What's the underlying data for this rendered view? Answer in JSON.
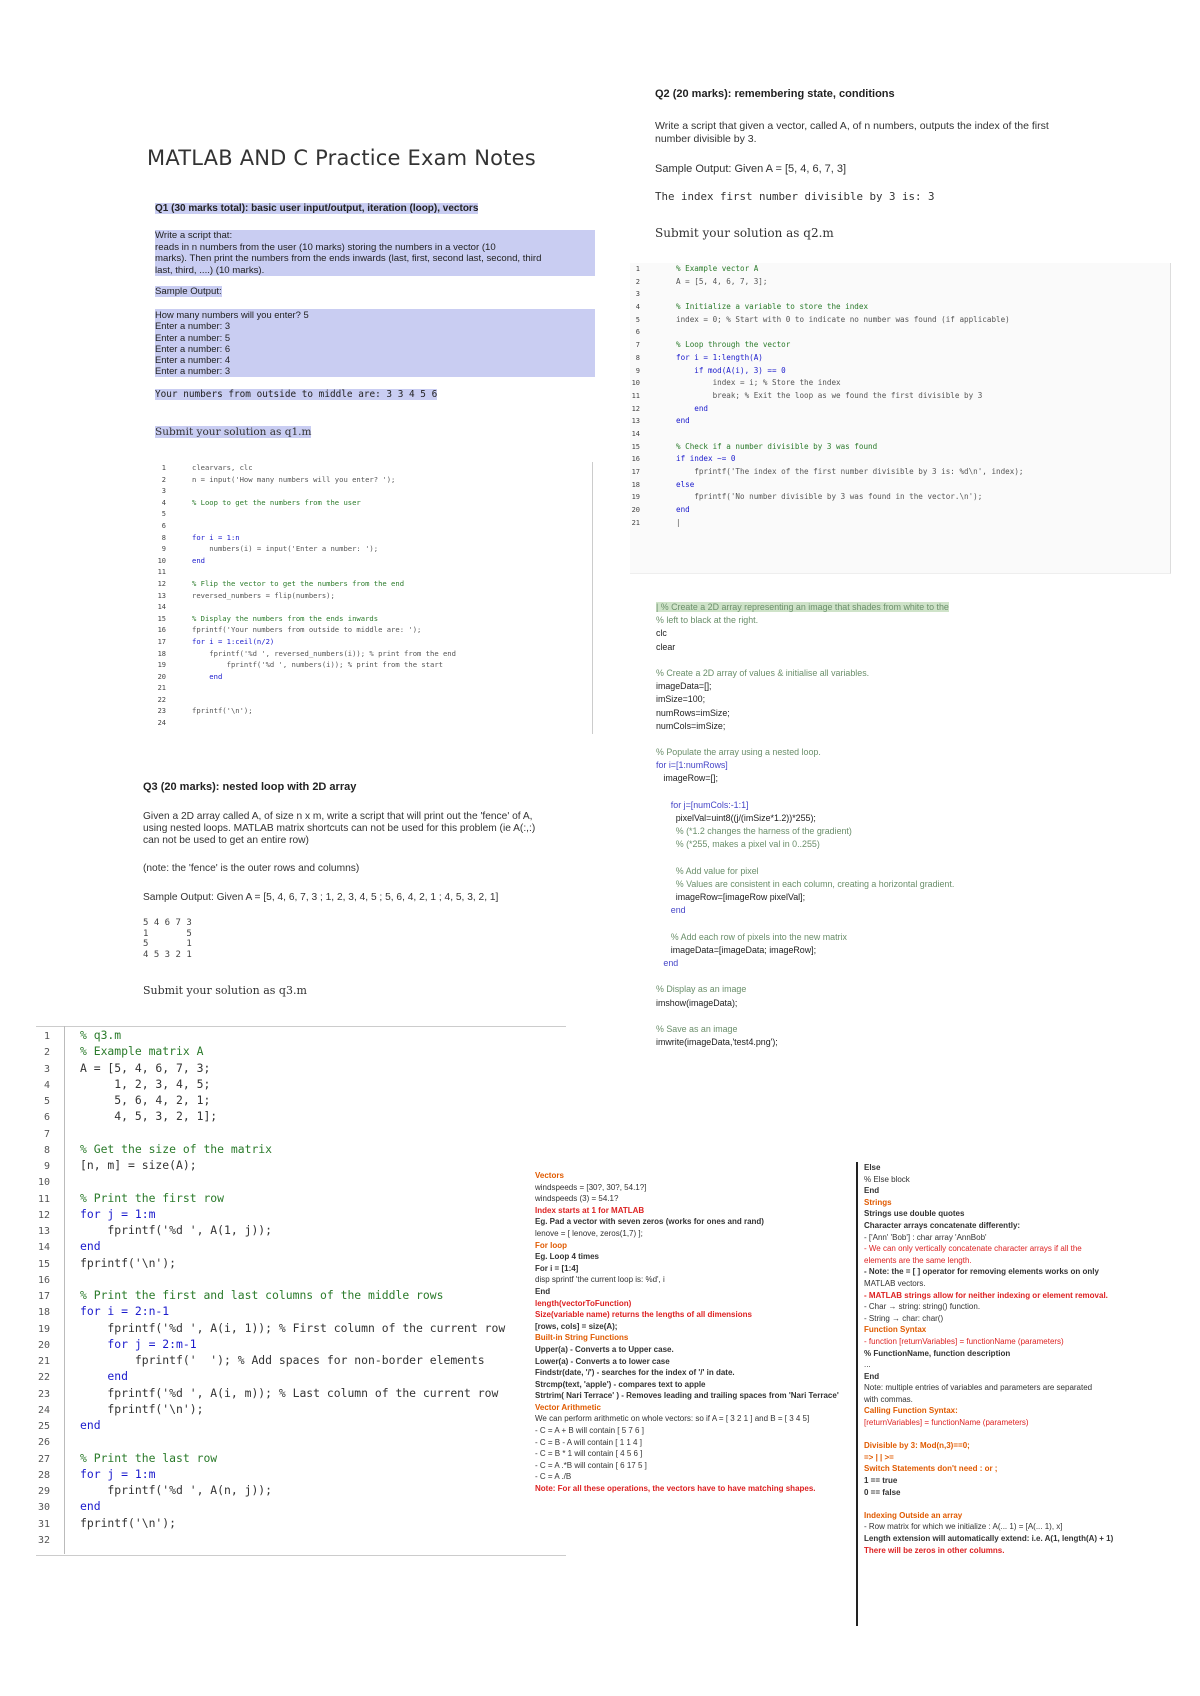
{
  "title": "MATLAB AND C Practice Exam Notes",
  "q1": {
    "heading": "Q1 (30 marks total): basic user input/output, iteration (loop), vectors",
    "prompt": [
      "Write a script that:",
      "reads in n numbers from the user (10 marks) storing the numbers in a vector (10",
      "marks).  Then print the numbers from the ends inwards (last, first, second last, second, third",
      "last, third, ....) (10 marks)."
    ],
    "sample_label": "Sample Output:",
    "sample_lines": [
      "How many numbers will you enter? 5",
      "Enter a number:  3",
      "Enter a number:  5",
      "Enter a number:  6",
      "Enter a number:  4",
      "Enter a number:  3"
    ],
    "result_line": "Your numbers from outside to middle are: 3 3 4 5 6",
    "submit": "Submit your solution as q1.m",
    "code": [
      {
        "n": "1",
        "t": "clearvars, clc",
        "c": ""
      },
      {
        "n": "2",
        "t": "n = input('How many numbers will you enter? ');",
        "c": ""
      },
      {
        "n": "3",
        "t": "",
        "c": ""
      },
      {
        "n": "4",
        "t": "% Loop to get the numbers from the user",
        "c": "cmt"
      },
      {
        "n": "5",
        "t": "",
        "c": ""
      },
      {
        "n": "6",
        "t": "",
        "c": ""
      },
      {
        "n": "8",
        "t": "for i = 1:n",
        "c": "kw"
      },
      {
        "n": "9",
        "t": "    numbers(i) = input('Enter a number: ');",
        "c": ""
      },
      {
        "n": "10",
        "t": "end",
        "c": "kw"
      },
      {
        "n": "11",
        "t": "",
        "c": ""
      },
      {
        "n": "12",
        "t": "% Flip the vector to get the numbers from the end",
        "c": "cmt"
      },
      {
        "n": "13",
        "t": "reversed_numbers = flip(numbers);",
        "c": ""
      },
      {
        "n": "14",
        "t": "",
        "c": ""
      },
      {
        "n": "15",
        "t": "% Display the numbers from the ends inwards",
        "c": "cmt"
      },
      {
        "n": "16",
        "t": "fprintf('Your numbers from outside to middle are: ');",
        "c": ""
      },
      {
        "n": "17",
        "t": "for i = 1:ceil(n/2)",
        "c": "kw"
      },
      {
        "n": "18",
        "t": "    fprintf('%d ', reversed_numbers(i)); % print from the end",
        "c": ""
      },
      {
        "n": "19",
        "t": "        fprintf('%d ', numbers(i)); % print from the start",
        "c": ""
      },
      {
        "n": "20",
        "t": "    end",
        "c": "kw"
      },
      {
        "n": "21",
        "t": "",
        "c": ""
      },
      {
        "n": "22",
        "t": "",
        "c": ""
      },
      {
        "n": "23",
        "t": "fprintf('\\n');",
        "c": ""
      },
      {
        "n": "24",
        "t": "",
        "c": ""
      }
    ]
  },
  "q2": {
    "heading": "Q2 (20 marks):  remembering state, conditions",
    "prompt": [
      "Write a script that given a vector, called A, of n numbers, outputs the index of the first",
      "number divisible by 3."
    ],
    "sample": "Sample Output:  Given A = [5, 4, 6, 7, 3]",
    "result_line": "The index first number divisible by 3 is: 3",
    "submit": "Submit your solution as q2.m",
    "code": [
      {
        "n": "1",
        "t": "% Example vector A",
        "c": "cmt"
      },
      {
        "n": "2",
        "t": "A = [5, 4, 6, 7, 3];",
        "c": ""
      },
      {
        "n": "3",
        "t": "",
        "c": ""
      },
      {
        "n": "4",
        "t": "% Initialize a variable to store the index",
        "c": "cmt"
      },
      {
        "n": "5",
        "t": "index = 0; % Start with 0 to indicate no number was found (if applicable)",
        "c": ""
      },
      {
        "n": "6",
        "t": "",
        "c": ""
      },
      {
        "n": "7",
        "t": "% Loop through the vector",
        "c": "cmt"
      },
      {
        "n": "8",
        "t": "for i = 1:length(A)",
        "c": "kw"
      },
      {
        "n": "9",
        "t": "    if mod(A(i), 3) == 0",
        "c": "kw"
      },
      {
        "n": "10",
        "t": "        index = i; % Store the index",
        "c": ""
      },
      {
        "n": "11",
        "t": "        break; % Exit the loop as we found the first divisible by 3",
        "c": ""
      },
      {
        "n": "12",
        "t": "    end",
        "c": "kw"
      },
      {
        "n": "13",
        "t": "end",
        "c": "kw"
      },
      {
        "n": "14",
        "t": "",
        "c": ""
      },
      {
        "n": "15",
        "t": "% Check if a number divisible by 3 was found",
        "c": "cmt"
      },
      {
        "n": "16",
        "t": "if index ~= 0",
        "c": "kw"
      },
      {
        "n": "17",
        "t": "    fprintf('The index of the first number divisible by 3 is: %d\\n', index);",
        "c": ""
      },
      {
        "n": "18",
        "t": "else",
        "c": "kw"
      },
      {
        "n": "19",
        "t": "    fprintf('No number divisible by 3 was found in the vector.\\n');",
        "c": ""
      },
      {
        "n": "20",
        "t": "end",
        "c": "kw"
      },
      {
        "n": "21",
        "t": "|",
        "c": ""
      }
    ]
  },
  "image_notes": [
    {
      "t": "| % Create a 2D array representing an image that shades from white to the",
      "c": "cmt hlg"
    },
    {
      "t": "% left to black at the right.",
      "c": "cmt"
    },
    {
      "t": "clc",
      "c": ""
    },
    {
      "t": "clear",
      "c": ""
    },
    {
      "t": "",
      "c": ""
    },
    {
      "t": "% Create a 2D array of values & initialise all variables.",
      "c": "cmt"
    },
    {
      "t": "imageData=[];",
      "c": ""
    },
    {
      "t": "imSize=100;",
      "c": ""
    },
    {
      "t": "numRows=imSize;",
      "c": ""
    },
    {
      "t": "numCols=imSize;",
      "c": ""
    },
    {
      "t": "",
      "c": ""
    },
    {
      "t": "% Populate the array using a nested loop.",
      "c": "cmt"
    },
    {
      "t": "for i=[1:numRows]",
      "c": "kw"
    },
    {
      "t": "   imageRow=[];",
      "c": ""
    },
    {
      "t": "",
      "c": ""
    },
    {
      "t": "      for j=[numCols:-1:1]",
      "c": "kw"
    },
    {
      "t": "        pixelVal=uint8((j/(imSize*1.2))*255);",
      "c": ""
    },
    {
      "t": "        % (*1.2 changes the harness of the gradient)",
      "c": "cmt"
    },
    {
      "t": "        % (*255, makes a pixel val in 0..255)",
      "c": "cmt"
    },
    {
      "t": "",
      "c": ""
    },
    {
      "t": "        % Add value for pixel",
      "c": "cmt"
    },
    {
      "t": "        % Values are consistent in each column, creating a horizontal gradient.",
      "c": "cmt"
    },
    {
      "t": "        imageRow=[imageRow pixelVal];",
      "c": ""
    },
    {
      "t": "      end",
      "c": "kw"
    },
    {
      "t": "",
      "c": ""
    },
    {
      "t": "      % Add each row of pixels into the new matrix",
      "c": "cmt"
    },
    {
      "t": "      imageData=[imageData; imageRow];",
      "c": ""
    },
    {
      "t": "   end",
      "c": "kw"
    },
    {
      "t": "",
      "c": ""
    },
    {
      "t": "% Display as an image",
      "c": "cmt"
    },
    {
      "t": "imshow(imageData);",
      "c": ""
    },
    {
      "t": "",
      "c": ""
    },
    {
      "t": "% Save as an image",
      "c": "cmt"
    },
    {
      "t": "imwrite(imageData,'test4.png');",
      "c": ""
    }
  ],
  "q3": {
    "heading": "Q3 (20 marks): nested loop with 2D array",
    "prompt": [
      "Given a 2D array  called A, of size n x m, write a script that will print out the 'fence' of A,",
      "using nested loops.  MATLAB matrix shortcuts can not be used for this problem (ie A(:,:)",
      "can not be used to get an entire row)"
    ],
    "note": "(note: the 'fence' is the outer rows and columns)",
    "sample": "Sample Output:  Given A = [5, 4, 6, 7, 3 ; 1, 2, 3, 4, 5 ; 5, 6, 4, 2, 1 ; 4, 5, 3, 2, 1]",
    "fence": [
      "5 4 6 7 3",
      "1       5",
      "5       1",
      "4 5 3 2 1"
    ],
    "submit": "Submit your solution as q3.m",
    "code": [
      {
        "n": "1",
        "t": "% q3.m",
        "c": "cmt"
      },
      {
        "n": "2",
        "t": "% Example matrix A",
        "c": "cmt"
      },
      {
        "n": "3",
        "t": "A = [5, 4, 6, 7, 3;",
        "c": ""
      },
      {
        "n": "4",
        "t": "     1, 2, 3, 4, 5;",
        "c": ""
      },
      {
        "n": "5",
        "t": "     5, 6, 4, 2, 1;",
        "c": ""
      },
      {
        "n": "6",
        "t": "     4, 5, 3, 2, 1];",
        "c": ""
      },
      {
        "n": "7",
        "t": "",
        "c": ""
      },
      {
        "n": "8",
        "t": "% Get the size of the matrix",
        "c": "cmt"
      },
      {
        "n": "9",
        "t": "[n, m] = size(A);",
        "c": ""
      },
      {
        "n": "10",
        "t": "",
        "c": ""
      },
      {
        "n": "11",
        "t": "% Print the first row",
        "c": "cmt"
      },
      {
        "n": "12",
        "t": "for j = 1:m",
        "c": "kw"
      },
      {
        "n": "13",
        "t": "    fprintf('%d ', A(1, j));",
        "c": ""
      },
      {
        "n": "14",
        "t": "end",
        "c": "kw"
      },
      {
        "n": "15",
        "t": "fprintf('\\n');",
        "c": ""
      },
      {
        "n": "16",
        "t": "",
        "c": ""
      },
      {
        "n": "17",
        "t": "% Print the first and last columns of the middle rows",
        "c": "cmt"
      },
      {
        "n": "18",
        "t": "for i = 2:n-1",
        "c": "kw"
      },
      {
        "n": "19",
        "t": "    fprintf('%d ', A(i, 1)); % First column of the current row",
        "c": ""
      },
      {
        "n": "20",
        "t": "    for j = 2:m-1",
        "c": "kw"
      },
      {
        "n": "21",
        "t": "        fprintf('  '); % Add spaces for non-border elements",
        "c": ""
      },
      {
        "n": "22",
        "t": "    end",
        "c": "kw"
      },
      {
        "n": "23",
        "t": "    fprintf('%d ', A(i, m)); % Last column of the current row",
        "c": ""
      },
      {
        "n": "24",
        "t": "    fprintf('\\n');",
        "c": ""
      },
      {
        "n": "25",
        "t": "end",
        "c": "kw"
      },
      {
        "n": "26",
        "t": "",
        "c": ""
      },
      {
        "n": "27",
        "t": "% Print the last row",
        "c": "cmt"
      },
      {
        "n": "28",
        "t": "for j = 1:m",
        "c": "kw"
      },
      {
        "n": "29",
        "t": "    fprintf('%d ', A(n, j));",
        "c": ""
      },
      {
        "n": "30",
        "t": "end",
        "c": "kw"
      },
      {
        "n": "31",
        "t": "fprintf('\\n');",
        "c": ""
      },
      {
        "n": "32",
        "t": "",
        "c": ""
      }
    ]
  },
  "cheat_left": [
    {
      "t": "Vectors",
      "c": "or"
    },
    {
      "t": "windspeeds = [30?, 30?, 54.1?]",
      "c": ""
    },
    {
      "t": "windspeeds (3) = 54.1?",
      "c": ""
    },
    {
      "t": "Index starts at 1 for MATLAB",
      "c": "rdb"
    },
    {
      "t": "Eg.  Pad a vector with seven zeros (works for ones and rand)",
      "c": "b"
    },
    {
      "t": "lenove = [ lenove, zeros(1,7) ];",
      "c": ""
    },
    {
      "t": "For loop",
      "c": "or"
    },
    {
      "t": "Eg. Loop 4 times",
      "c": "b"
    },
    {
      "t": "For i = [1:4]",
      "c": "b"
    },
    {
      "t": "        disp sprintf 'the current loop is: %d', i",
      "c": ""
    },
    {
      "t": "End",
      "c": "b"
    },
    {
      "t": "length(vectorToFunction)",
      "c": "rdb"
    },
    {
      "t": "Size(variable name) returns the lengths of all dimensions",
      "c": "rdb"
    },
    {
      "t": "[rows, cols] = size(A);",
      "c": "b"
    },
    {
      "t": "Built-in String Functions",
      "c": "or"
    },
    {
      "t": "Upper(a) - Converts a to Upper case.",
      "c": "b"
    },
    {
      "t": "Lower(a) - Converts a to lower case",
      "c": "b"
    },
    {
      "t": "Findstr(date, '/') - searches for the index of '/' in date.",
      "c": "b"
    },
    {
      "t": "Strcmp(text, 'apple') - compares text to apple",
      "c": "b"
    },
    {
      "t": "Strtrim( Nari Terrace' ) - Removes leading and trailing spaces from 'Nari Terrace'",
      "c": "b"
    },
    {
      "t": "Vector Arithmetic",
      "c": "or"
    },
    {
      "t": "We can perform arithmetic on whole vectors: so if A = [ 3 2 1 ] and B = [ 3 4 5]",
      "c": ""
    },
    {
      "t": "- C = A + B           will contain [ 5 7 6 ]",
      "c": ""
    },
    {
      "t": "- C = B - A           will contain [ 1 1 4 ]",
      "c": ""
    },
    {
      "t": "- C = B * 1           will contain [ 4 5 6 ]",
      "c": ""
    },
    {
      "t": "- C = A .*B           will contain [ 6 17 5 ]",
      "c": ""
    },
    {
      "t": "- C = A ./B",
      "c": ""
    },
    {
      "t": "Note: For all these operations, the vectors have to have matching shapes.",
      "c": "rdb"
    }
  ],
  "cheat_right": [
    {
      "t": "Else",
      "c": "b"
    },
    {
      "t": "        % Else block",
      "c": ""
    },
    {
      "t": "End",
      "c": "b"
    },
    {
      "t": "Strings",
      "c": "or"
    },
    {
      "t": "Strings use double quotes",
      "c": "b"
    },
    {
      "t": "Character arrays concatenate differently:",
      "c": "b"
    },
    {
      "t": "  - ['Ann' 'Bob'] : char array 'AnnBob'",
      "c": ""
    },
    {
      "t": "  - We can only vertically concatenate character arrays if all the",
      "c": "rd"
    },
    {
      "t": "    elements are the same length.",
      "c": "rd"
    },
    {
      "t": "  - Note: the = [ ] operator for removing elements works on only",
      "c": "b"
    },
    {
      "t": "    MATLAB vectors.",
      "c": ""
    },
    {
      "t": "  - MATLAB strings allow for neither indexing or element removal.",
      "c": "rdb"
    },
    {
      "t": "  - Char → string: string() function.",
      "c": ""
    },
    {
      "t": "  - String → char: char()",
      "c": ""
    },
    {
      "t": "Function Syntax",
      "c": "or"
    },
    {
      "t": "  - function [returnVariables] = functionName (parameters)",
      "c": "rd"
    },
    {
      "t": "    % FunctionName, function description",
      "c": "b"
    },
    {
      "t": "    ...",
      "c": ""
    },
    {
      "t": "End",
      "c": "b"
    },
    {
      "t": "Note: multiple entries of variables and parameters are separated",
      "c": ""
    },
    {
      "t": "    with commas.",
      "c": ""
    },
    {
      "t": "Calling Function Syntax:",
      "c": "or"
    },
    {
      "t": "  [returnVariables] = functionName (parameters)",
      "c": "rd"
    },
    {
      "t": "",
      "c": ""
    },
    {
      "t": "Divisible by 3: Mod(n,3)==0;",
      "c": "or"
    },
    {
      "t": "=> | | >=",
      "c": "or"
    },
    {
      "t": "Switch Statements don't need : or ;",
      "c": "or"
    },
    {
      "t": "1 == true",
      "c": "b"
    },
    {
      "t": "0 == false",
      "c": "b"
    },
    {
      "t": "",
      "c": ""
    },
    {
      "t": "Indexing Outside an array",
      "c": "or"
    },
    {
      "t": "  - Row matrix for which we initialize : A(... 1) = [A(... 1), x]",
      "c": ""
    },
    {
      "t": "    Length extension will automatically extend: i.e. A(1, length(A) + 1)",
      "c": "b"
    },
    {
      "t": "    There will be zeros in other columns.",
      "c": "rdb"
    }
  ]
}
